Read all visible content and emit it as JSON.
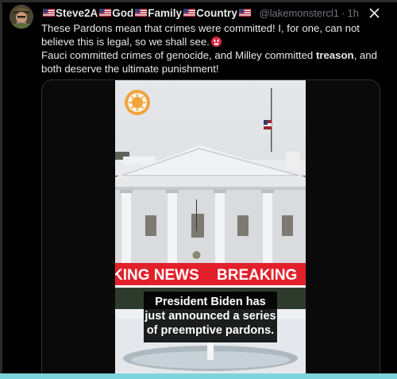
{
  "post": {
    "display_name_parts": [
      "Steve2A",
      "God",
      "Family",
      "Country"
    ],
    "handle": "@lakemonstercl1",
    "separator": "·",
    "time": "1h",
    "body_line1": "These Pardons mean that crimes were committed! I, for one, can not believe this is legal, so we shall see.",
    "body_line2_before": "Fauci committed crimes of genocide, and Milley committed ",
    "body_line2_bold": "treason",
    "body_line2_after": ", and both deserve the ultimate punishment!"
  },
  "video": {
    "banner_left": "KING NEWS",
    "banner_right": "BREAKING",
    "caption": "President Biden has just announced a series of preemptive pardons."
  },
  "icons": {
    "verified": "verified-badge-icon",
    "close": "close-icon",
    "flag": "us-flag-icon",
    "emoji": "angry-face-emoji",
    "overlay_logo": "sun-logo-icon"
  },
  "colors": {
    "background": "#000000",
    "text": "#e7e9ea",
    "muted": "#71767b",
    "verified": "#1d9bf0",
    "breaking_red": "#e3202a",
    "bottom_bar": "#7fd3dc"
  }
}
